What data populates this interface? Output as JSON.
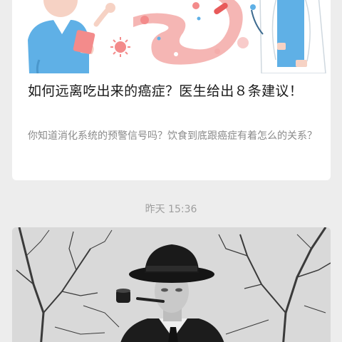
{
  "feed": {
    "article_1": {
      "title": "如何远离吃出来的癌症？医生给出８条建议！",
      "digest": "你知道消化系统的预警信号吗？饮食到底跟癌症有着怎么的关系？",
      "cover": "digestive-health-illustration"
    },
    "timestamp": "昨天 15:36",
    "article_2": {
      "cover": "black-and-white-portrait-photo"
    }
  },
  "colors": {
    "background": "#ededed",
    "card": "#ffffff",
    "title_text": "#1a1a1a",
    "digest_text": "#8a8a8a",
    "timestamp_text": "#9e9e9e",
    "illustration_pink": "#f3a9a7",
    "illustration_blue": "#5fb0e6"
  }
}
